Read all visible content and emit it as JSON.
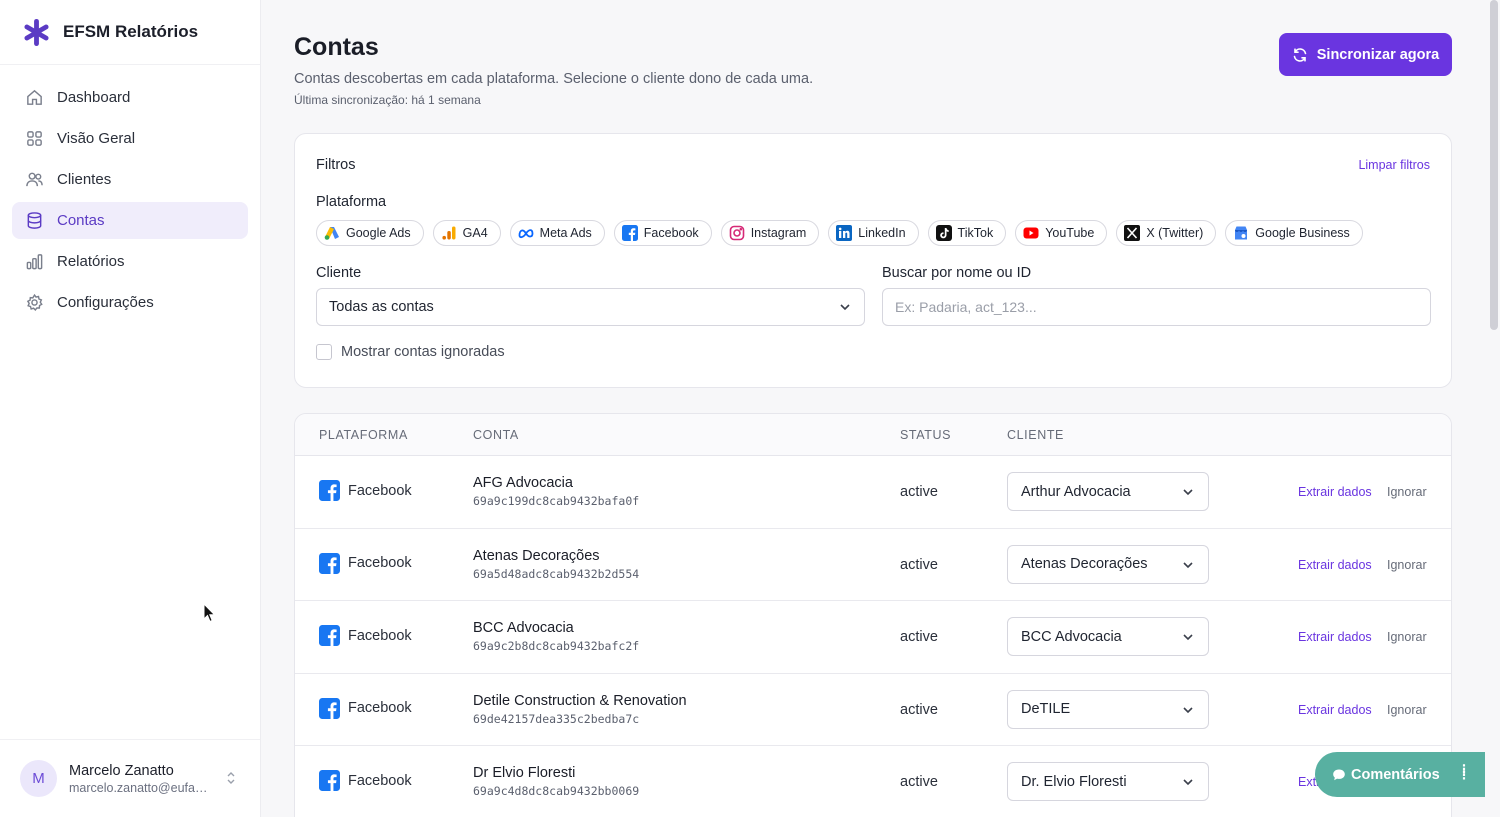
{
  "brand": {
    "title": "EFSM Relatórios",
    "color": "#5b3bc4"
  },
  "nav": [
    {
      "label": "Dashboard",
      "icon": "home-icon"
    },
    {
      "label": "Visão Geral",
      "icon": "grid-icon"
    },
    {
      "label": "Clientes",
      "icon": "users-icon"
    },
    {
      "label": "Contas",
      "icon": "database-icon",
      "active": true
    },
    {
      "label": "Relatórios",
      "icon": "bar-chart-icon"
    },
    {
      "label": "Configurações",
      "icon": "gear-icon"
    }
  ],
  "user": {
    "initial": "M",
    "name": "Marcelo Zanatto",
    "email": "marcelo.zanatto@eufac..."
  },
  "page": {
    "title": "Contas",
    "subtitle": "Contas descobertas em cada plataforma. Selecione o cliente dono de cada uma.",
    "last_sync": "Última sincronização: há 1 semana",
    "sync_button": "Sincronizar agora"
  },
  "filters": {
    "title": "Filtros",
    "clear": "Limpar filtros",
    "platform_label": "Plataforma",
    "platforms": [
      "Google Ads",
      "GA4",
      "Meta Ads",
      "Facebook",
      "Instagram",
      "LinkedIn",
      "TikTok",
      "YouTube",
      "X (Twitter)",
      "Google Business"
    ],
    "client_label": "Cliente",
    "client_value": "Todas as contas",
    "search_label": "Buscar por nome ou ID",
    "search_placeholder": "Ex: Padaria, act_123...",
    "show_ignored": "Mostrar contas ignoradas"
  },
  "table": {
    "headers": {
      "platform": "PLATAFORMA",
      "account": "CONTA",
      "status": "STATUS",
      "client": "CLIENTE"
    },
    "extract_label": "Extrair dados",
    "ignore_label": "Ignorar",
    "rows": [
      {
        "platform": "Facebook",
        "name": "AFG Advocacia",
        "id": "69a9c199dc8cab9432bafa0f",
        "status": "active",
        "client": "Arthur Advocacia"
      },
      {
        "platform": "Facebook",
        "name": "Atenas Decorações",
        "id": "69a5d48adc8cab9432b2d554",
        "status": "active",
        "client": "Atenas Decorações"
      },
      {
        "platform": "Facebook",
        "name": "BCC Advocacia",
        "id": "69a9c2b8dc8cab9432bafc2f",
        "status": "active",
        "client": "BCC Advocacia"
      },
      {
        "platform": "Facebook",
        "name": "Detile Construction & Renovation",
        "id": "69de42157dea335c2bedba7c",
        "status": "active",
        "client": "DeTILE"
      },
      {
        "platform": "Facebook",
        "name": "Dr Elvio Floresti",
        "id": "69a9c4d8dc8cab9432bb0069",
        "status": "active",
        "client": "Dr. Elvio Floresti"
      }
    ]
  },
  "comments": {
    "label": "Comentários",
    "color": "#58b0a1"
  },
  "colors": {
    "accent": "#6a35e0",
    "active_nav_bg": "#f0edfb",
    "facebook": "#1877f2"
  }
}
